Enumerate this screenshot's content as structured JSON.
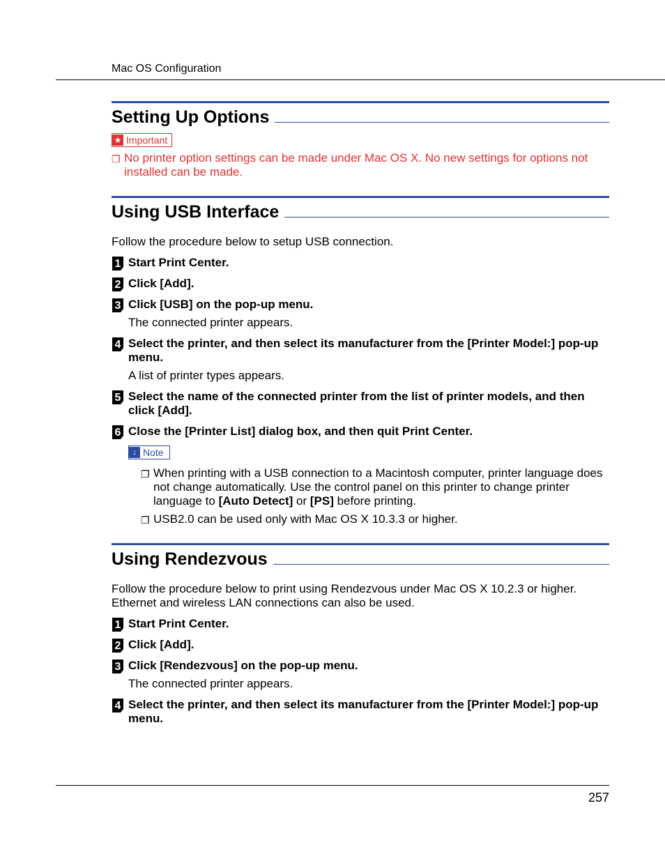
{
  "header": "Mac OS Configuration",
  "page_number": "257",
  "sections": [
    {
      "heading": "Setting Up Options",
      "important_label": "Important",
      "important_text": "No printer option settings can be made under Mac OS X. No new settings for options not installed can be made."
    },
    {
      "heading": "Using USB Interface",
      "intro": "Follow the procedure below to setup USB connection.",
      "steps": [
        {
          "title_html": "Start Print Center."
        },
        {
          "title_html": "Click <span class=\"condensed\">[Add]</span>."
        },
        {
          "title_html": "Click <span class=\"condensed\">[USB]</span> on the pop-up menu.",
          "body": "The connected printer appears."
        },
        {
          "title_html": "Select the printer, and then select its manufacturer from the <span class=\"condensed\">[Printer Model:]</span> pop-up menu.",
          "body": "A list of printer types appears."
        },
        {
          "title_html": "Select the name of the connected printer from the list of printer models, and then click <span class=\"condensed\">[Add]</span>."
        },
        {
          "title_html": "Close the <span class=\"condensed\">[Printer List]</span> dialog box, and then quit Print Center."
        }
      ],
      "note_label": "Note",
      "notes": [
        "When printing with a USB connection to a Macintosh computer, printer language does not change automatically. Use the control panel on this printer to change printer language to <span class=\"condensed\">[Auto Detect]</span> or <span class=\"condensed\">[PS]</span> before printing.",
        "USB2.0 can be used only with Mac OS X 10.3.3 or higher."
      ]
    },
    {
      "heading": "Using Rendezvous",
      "intro": "Follow the procedure below to print using Rendezvous under Mac OS X 10.2.3 or higher. Ethernet and wireless LAN connections can also be used.",
      "steps": [
        {
          "title_html": "Start Print Center."
        },
        {
          "title_html": "Click <span class=\"condensed\">[Add]</span>."
        },
        {
          "title_html": "Click <span class=\"condensed\">[Rendezvous]</span> on the pop-up menu.",
          "body": "The connected printer appears."
        },
        {
          "title_html": "Select the printer, and then select its manufacturer from the <span class=\"condensed\">[Printer Model:]</span> pop-up menu."
        }
      ]
    }
  ]
}
